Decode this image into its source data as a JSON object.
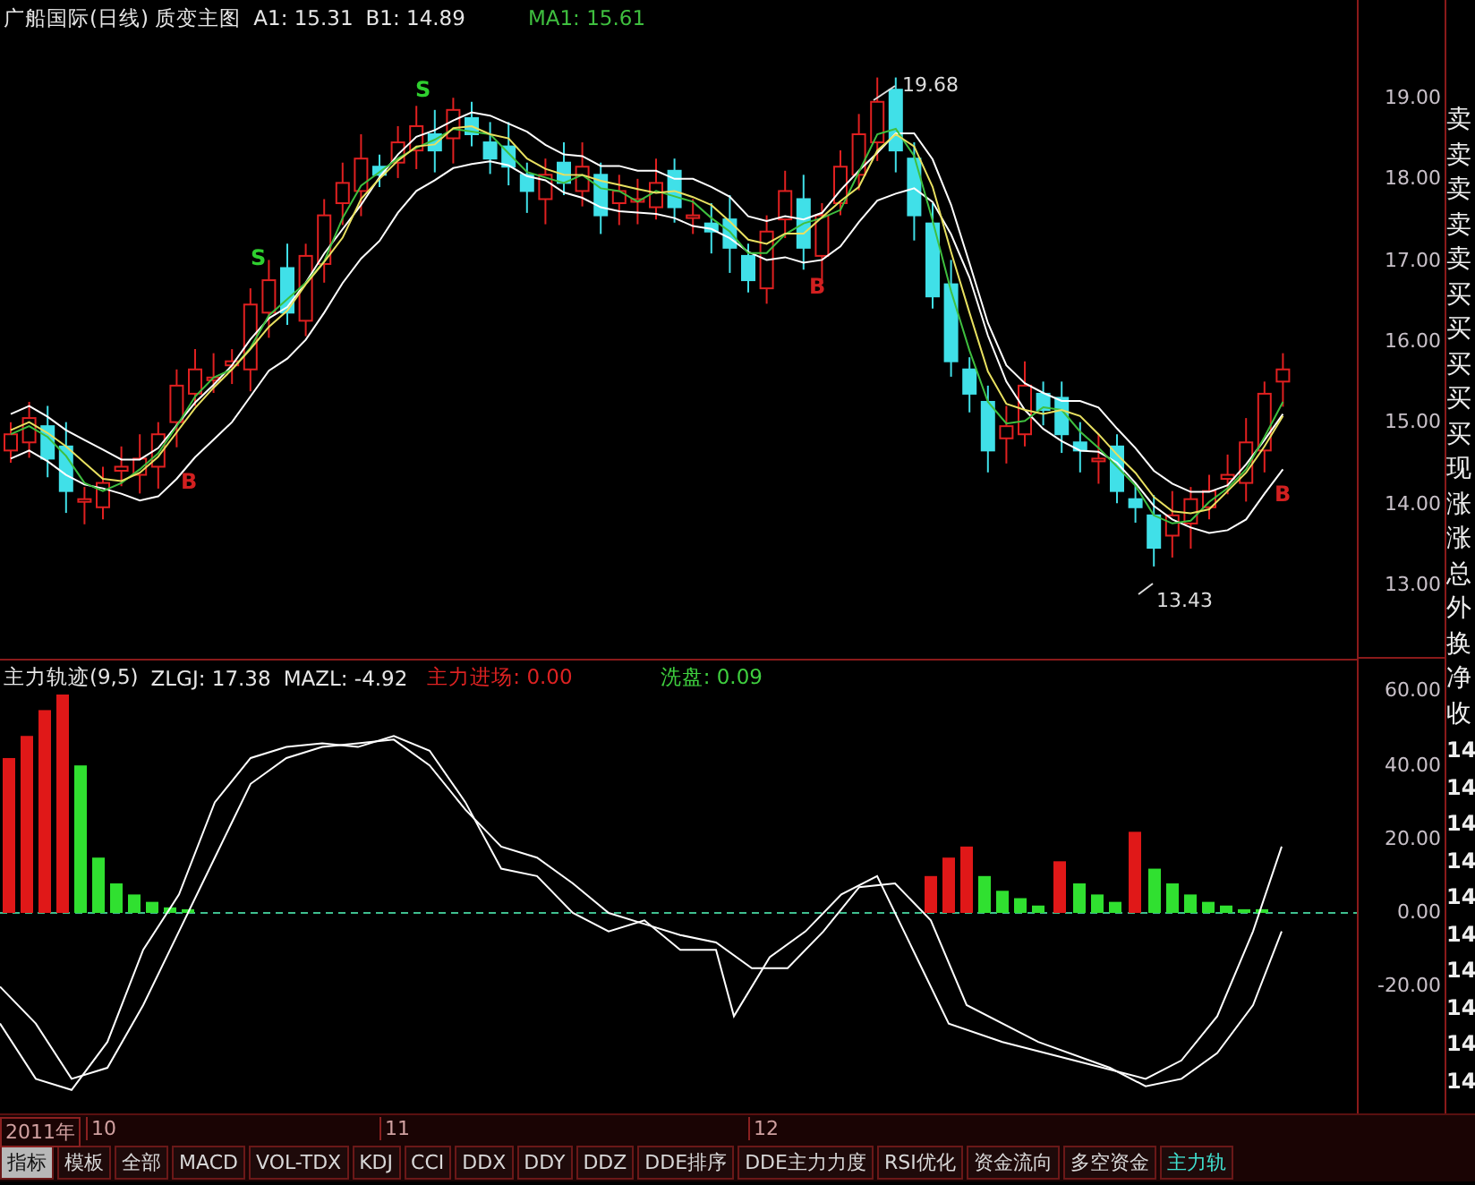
{
  "header": {
    "title": "广船国际(日线) 质变主图",
    "readings": [
      {
        "text": "A1: 15.31",
        "kind": "plain"
      },
      {
        "text": "B1: 14.89",
        "kind": "plain"
      },
      {
        "text": "MA1: 15.61",
        "kind": "ma"
      }
    ]
  },
  "price_chart": {
    "markers": [
      {
        "text": "S",
        "kind": "sell"
      },
      {
        "text": "S",
        "kind": "sell"
      },
      {
        "text": "B",
        "kind": "buy"
      },
      {
        "text": "B",
        "kind": "buy"
      },
      {
        "text": "B",
        "kind": "buy"
      },
      {
        "text": "19.68",
        "kind": "high"
      },
      {
        "text": "13.43",
        "kind": "low"
      }
    ],
    "axis_labels": [
      "19.00",
      "18.00",
      "17.00",
      "16.00",
      "15.00",
      "14.00",
      "13.00"
    ]
  },
  "indicator": {
    "title": "主力轨迹(9,5)",
    "readings": [
      {
        "text": "ZLGJ: 17.38",
        "kind": "plain"
      },
      {
        "text": "MAZL: -4.92",
        "kind": "plain"
      },
      {
        "text": "主力进场: 0.00",
        "kind": "inflow"
      },
      {
        "text": "洗盘: 0.09",
        "kind": "washout"
      }
    ],
    "axis_labels": [
      "60.00",
      "40.00",
      "20.00",
      "0.00",
      "-20.00"
    ]
  },
  "side_panel": {
    "labels": [
      "卖",
      "卖",
      "卖",
      "卖",
      "卖",
      "买",
      "买",
      "买",
      "买",
      "买",
      "现",
      "涨",
      "涨",
      "总",
      "外",
      "换",
      "净",
      "收"
    ],
    "values": [
      "14",
      "14",
      "14",
      "14",
      "14",
      "14",
      "14",
      "14",
      "14",
      "14"
    ]
  },
  "time_axis": {
    "labels": [
      {
        "text": "2011年",
        "kind": "year"
      },
      {
        "text": "10",
        "kind": "month"
      },
      {
        "text": "11",
        "kind": "month"
      },
      {
        "text": "12",
        "kind": "month"
      }
    ]
  },
  "tabs": [
    {
      "label": "指标",
      "selected": true,
      "current": false
    },
    {
      "label": "模板",
      "selected": false,
      "current": false
    },
    {
      "label": "全部",
      "selected": false,
      "current": false
    },
    {
      "label": "MACD",
      "selected": false,
      "current": false
    },
    {
      "label": "VOL-TDX",
      "selected": false,
      "current": false
    },
    {
      "label": "KDJ",
      "selected": false,
      "current": false
    },
    {
      "label": "CCI",
      "selected": false,
      "current": false
    },
    {
      "label": "DDX",
      "selected": false,
      "current": false
    },
    {
      "label": "DDY",
      "selected": false,
      "current": false
    },
    {
      "label": "DDZ",
      "selected": false,
      "current": false
    },
    {
      "label": "DDE排序",
      "selected": false,
      "current": false
    },
    {
      "label": "DDE主力力度",
      "selected": false,
      "current": false
    },
    {
      "label": "RSI优化",
      "selected": false,
      "current": false
    },
    {
      "label": "资金流向",
      "selected": false,
      "current": false
    },
    {
      "label": "多空资金",
      "selected": false,
      "current": false
    },
    {
      "label": "主力轨",
      "selected": false,
      "current": true
    }
  ]
}
